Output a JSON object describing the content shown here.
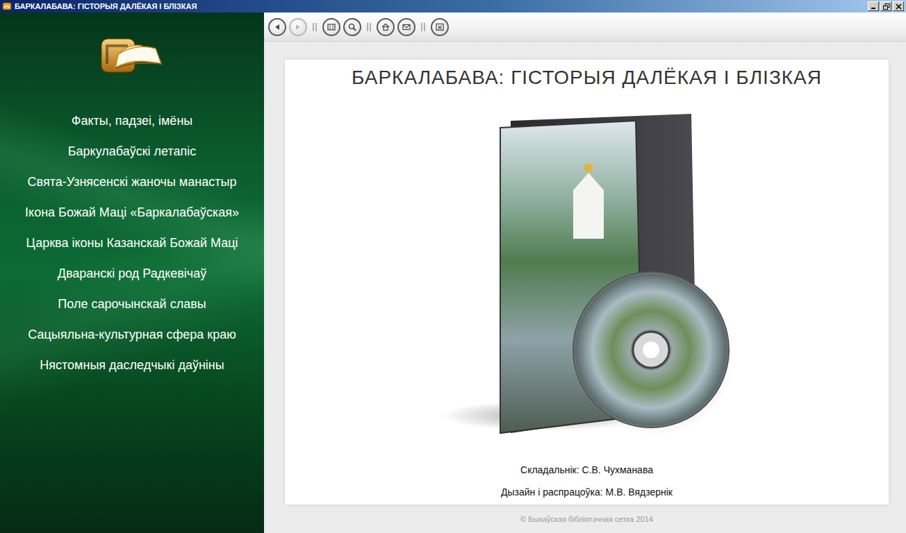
{
  "window": {
    "title": "БАРКАЛАБАВА: ГІСТОРЫЯ ДАЛЁКАЯ І БЛІЗКАЯ"
  },
  "sidebar": {
    "items": [
      {
        "label": "Факты, падзеі, імёны"
      },
      {
        "label": "Баркулабаўскі летапіс"
      },
      {
        "label": "Свята-Узнясенскі жаночы манастыр"
      },
      {
        "label": "Ікона Божай Маці «Баркалабаўская»"
      },
      {
        "label": "Царква іконы Казанскай Божай Маці"
      },
      {
        "label": "Дваранскі род Радкевічаў"
      },
      {
        "label": "Поле сарочынскай славы"
      },
      {
        "label": "Сацыяльна-культурная сфера краю"
      },
      {
        "label": "Нястомныя даследчыкі даўніны"
      }
    ]
  },
  "toolbar": {
    "buttons": [
      {
        "kind": "back",
        "disabled": false
      },
      {
        "kind": "forward",
        "disabled": true
      },
      {
        "kind": "contents",
        "disabled": false
      },
      {
        "kind": "search",
        "disabled": false
      },
      {
        "kind": "home",
        "disabled": false
      },
      {
        "kind": "mail",
        "disabled": false
      },
      {
        "kind": "exit",
        "disabled": false
      }
    ]
  },
  "content": {
    "title": "БАРКАЛАБАВА: ГІСТОРЫЯ ДАЛЁКАЯ І БЛІЗКАЯ",
    "credits": [
      "Складальнік: С.В. Чухманава",
      "Дызайн і распрацоўка: М.В. Вядзернік"
    ]
  },
  "footer": "© Быхаўская бібліятэчная сетка 2014"
}
